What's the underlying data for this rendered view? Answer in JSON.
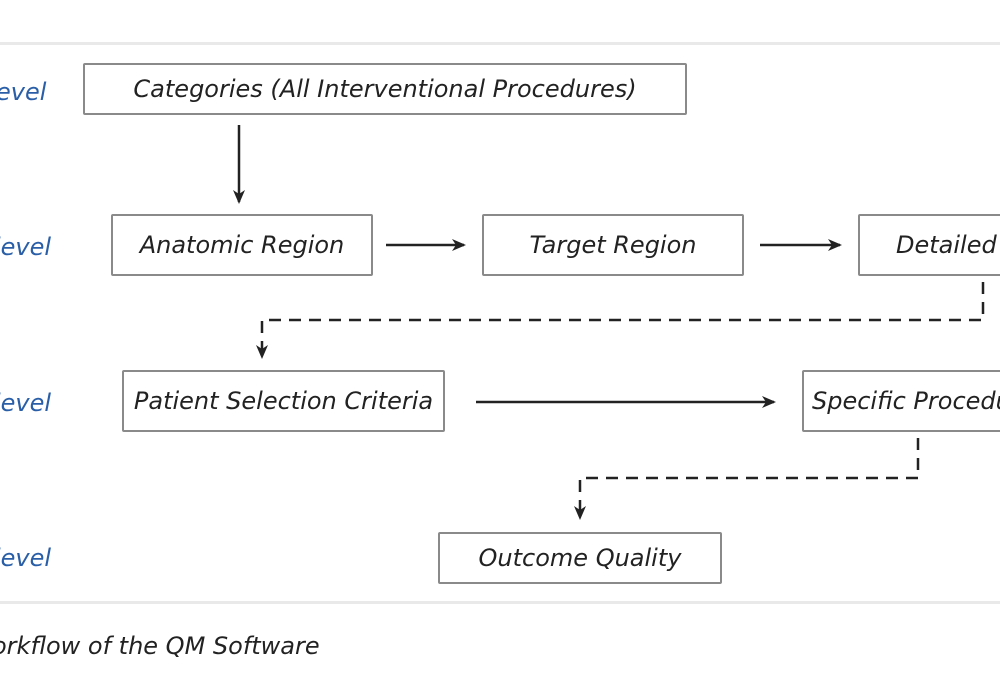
{
  "levels": [
    "Level",
    "level",
    "level",
    "level"
  ],
  "level_labels_visible": [
    "evel",
    "level",
    "level",
    "level"
  ],
  "nodes": {
    "categories": "Categories (All Interventional Procedures)",
    "anatomic": "Anatomic Region",
    "target": "Target Region",
    "detailed": "Detailed",
    "patient": "Patient Selection Criteria",
    "specific": "Specific Procedu",
    "outcome": "Outcome Quality"
  },
  "caption": "orkflow of the QM Software",
  "colors": {
    "level_label": "#2a5fa8",
    "box_border": "#8a8a8a",
    "arrow": "#222222"
  }
}
